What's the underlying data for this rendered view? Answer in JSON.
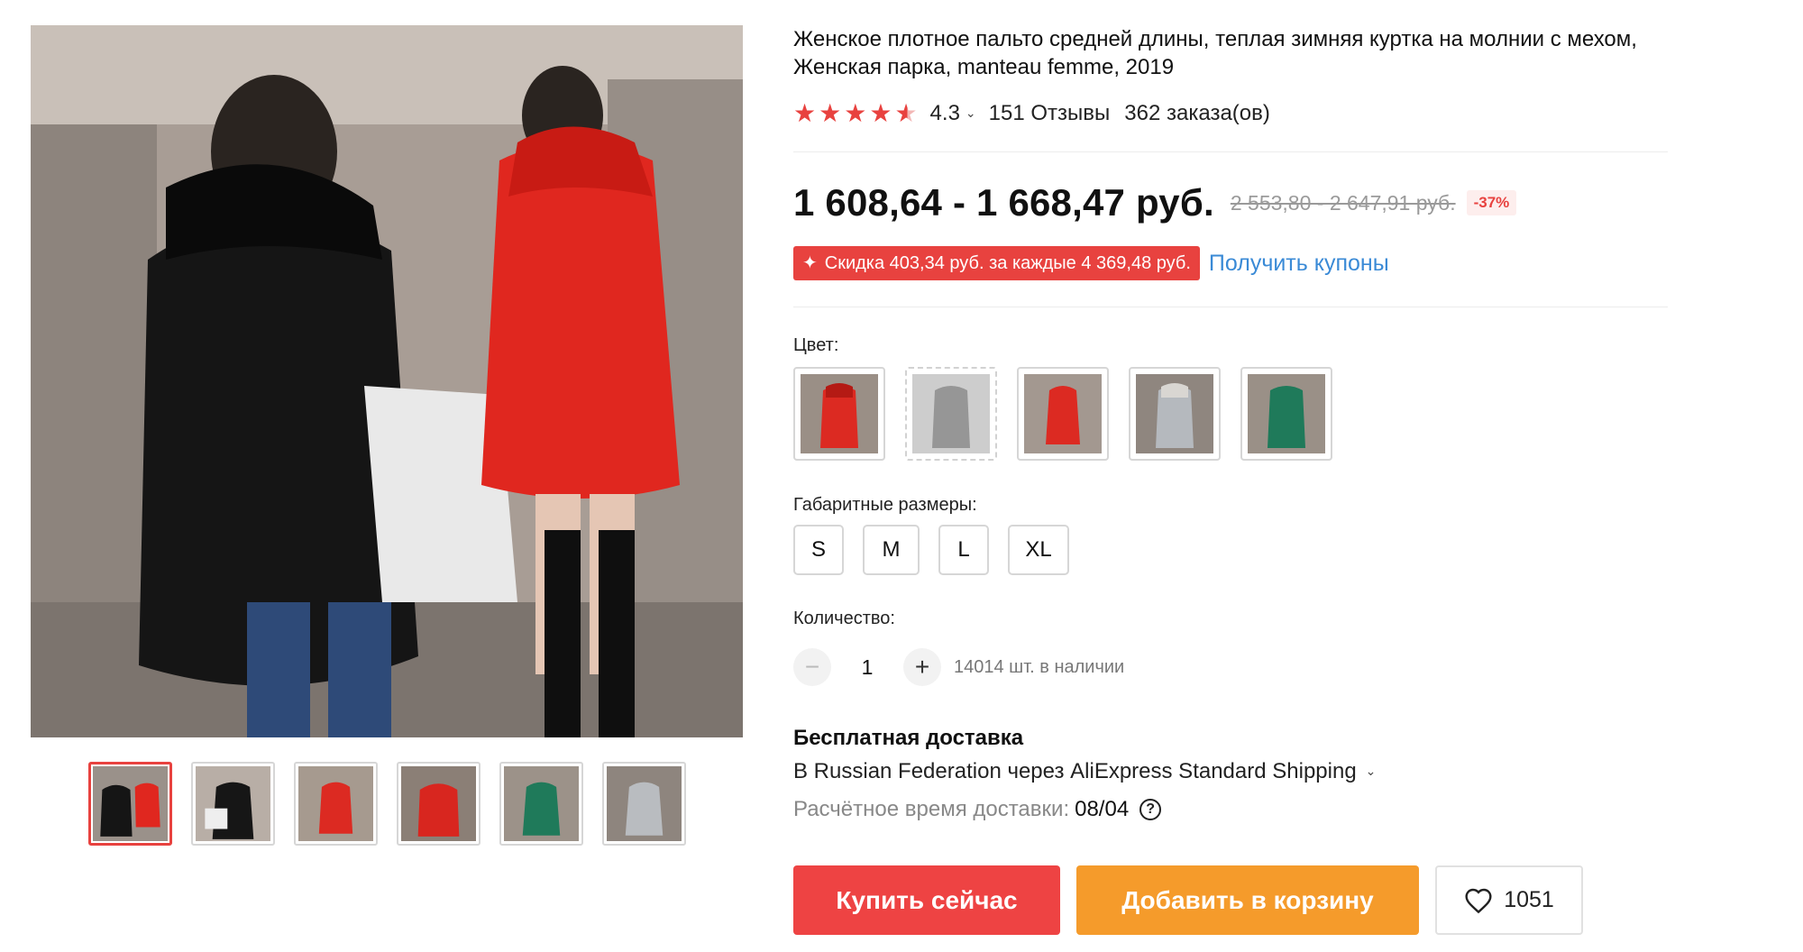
{
  "product": {
    "title": "Женское плотное пальто средней длины, теплая зимняя куртка на молнии с мехом, Женская парка, manteau femme, 2019",
    "rating": {
      "value": "4.3",
      "stars": 4.5,
      "reviews": "151 Отзывы",
      "orders": "362 заказа(ов)"
    },
    "price": {
      "current": "1 608,64 - 1 668,47 руб.",
      "old": "2 553,80 - 2 647,91 руб.",
      "discount": "-37%"
    },
    "coupon": {
      "badge": "Скидка 403,34 руб. за каждые 4 369,48 руб.",
      "link": "Получить купоны"
    }
  },
  "gallery": {
    "thumbnails": [
      "black-and-red",
      "black-white-bag",
      "red",
      "red-front",
      "green",
      "grey"
    ],
    "active_index": 0
  },
  "options": {
    "color_label": "Цвет:",
    "colors": [
      "red",
      "black",
      "red",
      "grey",
      "green"
    ],
    "size_label": "Габаритные размеры:",
    "sizes": [
      "S",
      "M",
      "L",
      "XL"
    ]
  },
  "quantity": {
    "label": "Количество:",
    "value": "1",
    "stock": "14014 шт. в наличии"
  },
  "shipping": {
    "title": "Бесплатная доставка",
    "method": "В Russian Federation через AliExpress Standard Shipping",
    "eta_label": "Расчётное время доставки:",
    "eta_value": "08/04"
  },
  "actions": {
    "buy": "Купить сейчас",
    "cart": "Добавить в корзину",
    "wishlist_count": "1051"
  },
  "colors": {
    "accent_red": "#e8423f",
    "buy_red": "#ee4343",
    "cart_orange": "#f59b2b",
    "link_blue": "#3a8ad6"
  }
}
